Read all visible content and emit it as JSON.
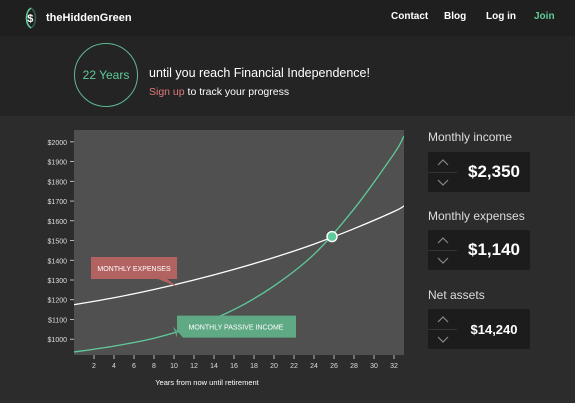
{
  "nav": {
    "brand": "theHiddenGreen",
    "links": [
      "Contact",
      "Blog",
      "Log in",
      "Join"
    ]
  },
  "hero": {
    "years": "22 Years",
    "title": "until you reach Financial Independence!",
    "signup": "Sign up",
    "subtitle_rest": "to track your progress"
  },
  "panels": {
    "income_label": "Monthly income",
    "income_value": "$2,350",
    "expenses_label": "Monthly expenses",
    "expenses_value": "$1,140",
    "assets_label": "Net assets",
    "assets_value": "$14,240"
  },
  "chart_data": {
    "type": "line",
    "xlabel": "Years from now until retirement",
    "xlim": [
      0,
      33
    ],
    "ylim": [
      920,
      2060
    ],
    "x_ticks": [
      2,
      4,
      6,
      8,
      10,
      12,
      14,
      16,
      18,
      20,
      22,
      24,
      26,
      28,
      30,
      32
    ],
    "y_ticks": [
      1000,
      1100,
      1200,
      1300,
      1400,
      1500,
      1600,
      1700,
      1800,
      1900,
      2000
    ],
    "y_tick_labels": [
      "$1000",
      "$1100",
      "$1200",
      "$1300",
      "$1400",
      "$1500",
      "$1600",
      "$1700",
      "$1800",
      "$1900",
      "$2000"
    ],
    "series": [
      {
        "name": "MONTHLY EXPENSES",
        "color": "#ffffff",
        "x": [
          0,
          4,
          8,
          12,
          16,
          20,
          24,
          28,
          32,
          33
        ],
        "y": [
          1175,
          1210,
          1252,
          1300,
          1354,
          1414,
          1482,
          1560,
          1647,
          1675
        ]
      },
      {
        "name": "MONTHLY PASSIVE INCOME",
        "color": "#5fcb9a",
        "x": [
          0,
          4,
          8,
          12,
          16,
          20,
          24,
          28,
          32,
          33
        ],
        "y": [
          935,
          965,
          1005,
          1065,
          1150,
          1270,
          1430,
          1660,
          1940,
          2030
        ]
      }
    ],
    "intersection": {
      "x": 25.8,
      "y": 1520
    },
    "labels": [
      {
        "text": "MONTHLY EXPENSES",
        "color": "#b36262",
        "anchor_x": 5.2,
        "anchor_y": 1275
      },
      {
        "text": "MONTHLY PASSIVE INCOME",
        "color": "#5fa985",
        "anchor_x": 19.5,
        "anchor_y": 1035
      }
    ],
    "colors": {
      "plot_bg": "#505050",
      "tick": "#dddddd",
      "accent": "#5fcb9a"
    }
  }
}
